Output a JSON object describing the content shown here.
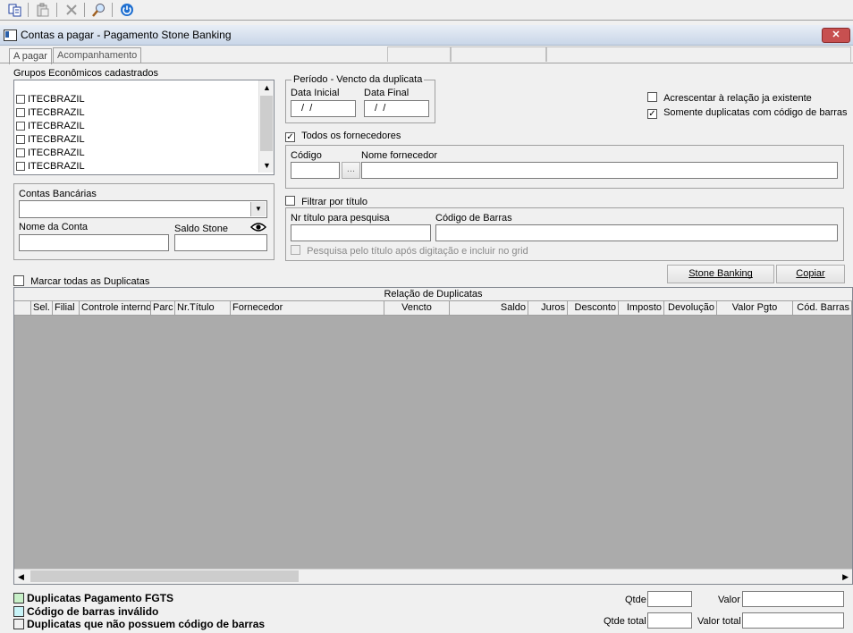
{
  "toolbar": {
    "icons": [
      "copy-icon",
      "paste-icon",
      "delete-icon",
      "search-icon",
      "power-icon"
    ]
  },
  "window": {
    "title": "Contas a pagar - Pagamento Stone Banking",
    "close": "✕"
  },
  "tabs": [
    "A pagar",
    "Acompanhamento"
  ],
  "grupos": {
    "label": "Grupos Econômicos cadastrados",
    "items": [
      "ITECBRAZIL",
      "ITECBRAZIL",
      "ITECBRAZIL",
      "ITECBRAZIL",
      "ITECBRAZIL",
      "ITECBRAZIL"
    ]
  },
  "periodo": {
    "legend": "Período - Vencto da duplicata",
    "inicial_label": "Data Inicial",
    "final_label": "Data Final",
    "inicial_value": " /  /",
    "final_value": " /  /"
  },
  "options": {
    "acrescentar": "Acrescentar à relação ja existente",
    "acrescentar_checked": false,
    "somente": "Somente duplicatas com código de barras",
    "somente_checked": true
  },
  "fornecedores": {
    "todos_label": "Todos os fornecedores",
    "todos_checked": true,
    "codigo_label": "Código",
    "nome_label": "Nome fornecedor",
    "lookup": "..."
  },
  "contas": {
    "label": "Contas Bancárias",
    "nome_label": "Nome da Conta",
    "saldo_label": "Saldo Stone"
  },
  "filtro": {
    "label": "Filtrar por título",
    "checked": false,
    "nr_label": "Nr título para pesquisa",
    "barras_label": "Código de Barras",
    "pesquisa_label": "Pesquisa pelo título após digitação e incluir no grid"
  },
  "marcar": {
    "label": "Marcar todas as Duplicatas",
    "checked": false
  },
  "buttons": {
    "stone": "Stone Banking",
    "copiar": "Copiar"
  },
  "grid": {
    "title": "Relação de Duplicatas",
    "columns": [
      "Sel.",
      "Filial",
      "Controle interno",
      "Parc",
      "Nr.Título",
      "Fornecedor",
      "Vencto",
      "Saldo",
      "Juros",
      "Desconto",
      "Imposto",
      "Devolução",
      "Valor Pgto",
      "Cód. Barras"
    ]
  },
  "legend": [
    {
      "label": "Duplicatas Pagamento FGTS",
      "color": "#c8f0c8"
    },
    {
      "label": "Código de barras inválido",
      "color": "#c8f4f8"
    },
    {
      "label": "Duplicatas que não possuem código de barras",
      "color": "#f0f0f0"
    }
  ],
  "totals": {
    "qtde": "Qtde",
    "valor": "Valor",
    "qtde_total": "Qtde total",
    "valor_total": "Valor total"
  }
}
